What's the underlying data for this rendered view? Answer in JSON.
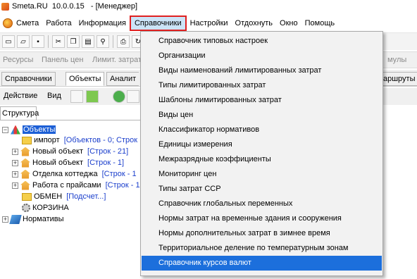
{
  "window": {
    "title": "Smeta.RU  10.0.0.15   - [Менеджер]"
  },
  "menubar": {
    "items": [
      "Смета",
      "Работа",
      "Информация",
      "Справочники",
      "Настройки",
      "Отдохнуть",
      "Окно",
      "Помощь"
    ],
    "active": "Справочники"
  },
  "gray_toolbar": {
    "items": [
      "Ресурсы",
      "Панель цен",
      "Лимит. затрат"
    ],
    "right_fragment": "мулы"
  },
  "tabs": {
    "items": [
      "Справочники",
      "Объекты",
      "Аналит"
    ],
    "selected": "Объекты",
    "right_fragment": "аршруты"
  },
  "action_row": {
    "action_label": "Действие",
    "view_label": "Вид"
  },
  "structure_tab": {
    "label": "Структура"
  },
  "tree": {
    "nodes": [
      {
        "label": "Объекты",
        "info": ""
      },
      {
        "label": "импорт",
        "info": "[Объектов - 0; Строк"
      },
      {
        "label": "Новый объект",
        "info": "[Строк - 21]"
      },
      {
        "label": "Новый объект",
        "info": "[Строк - 1]"
      },
      {
        "label": "Отделка коттеджа",
        "info": "[Строк - 1"
      },
      {
        "label": "Работа с прайсами",
        "info": "[Строк - 1"
      },
      {
        "label": "ОБМЕН",
        "info": "[Подсчет...]"
      },
      {
        "label": "КОРЗИНА",
        "info": ""
      },
      {
        "label": "Нормативы",
        "info": ""
      }
    ]
  },
  "dropdown": {
    "items": [
      "Справочник типовых настроек",
      "Организации",
      "Виды наименований лимитированных затрат",
      "Типы лимитированных затрат",
      "Шаблоны лимитированных затрат",
      "Виды цен",
      "Классификатор нормативов",
      "Единицы измерения",
      "Межразрядные коэффициенты",
      "Мониторинг цен",
      "Типы затрат ССР",
      "Справочник глобальных переменных",
      "Нормы затрат на временные здания и сооружения",
      "Нормы дополнительных затрат в зимнее время",
      "Территориальное деление по температурным зонам",
      "Справочник курсов валют"
    ],
    "highlighted": "Справочник курсов валют"
  },
  "colors": {
    "menu_highlight": "#1c6fdc",
    "active_border": "#e02020",
    "link_blue": "#1a3ecc"
  }
}
